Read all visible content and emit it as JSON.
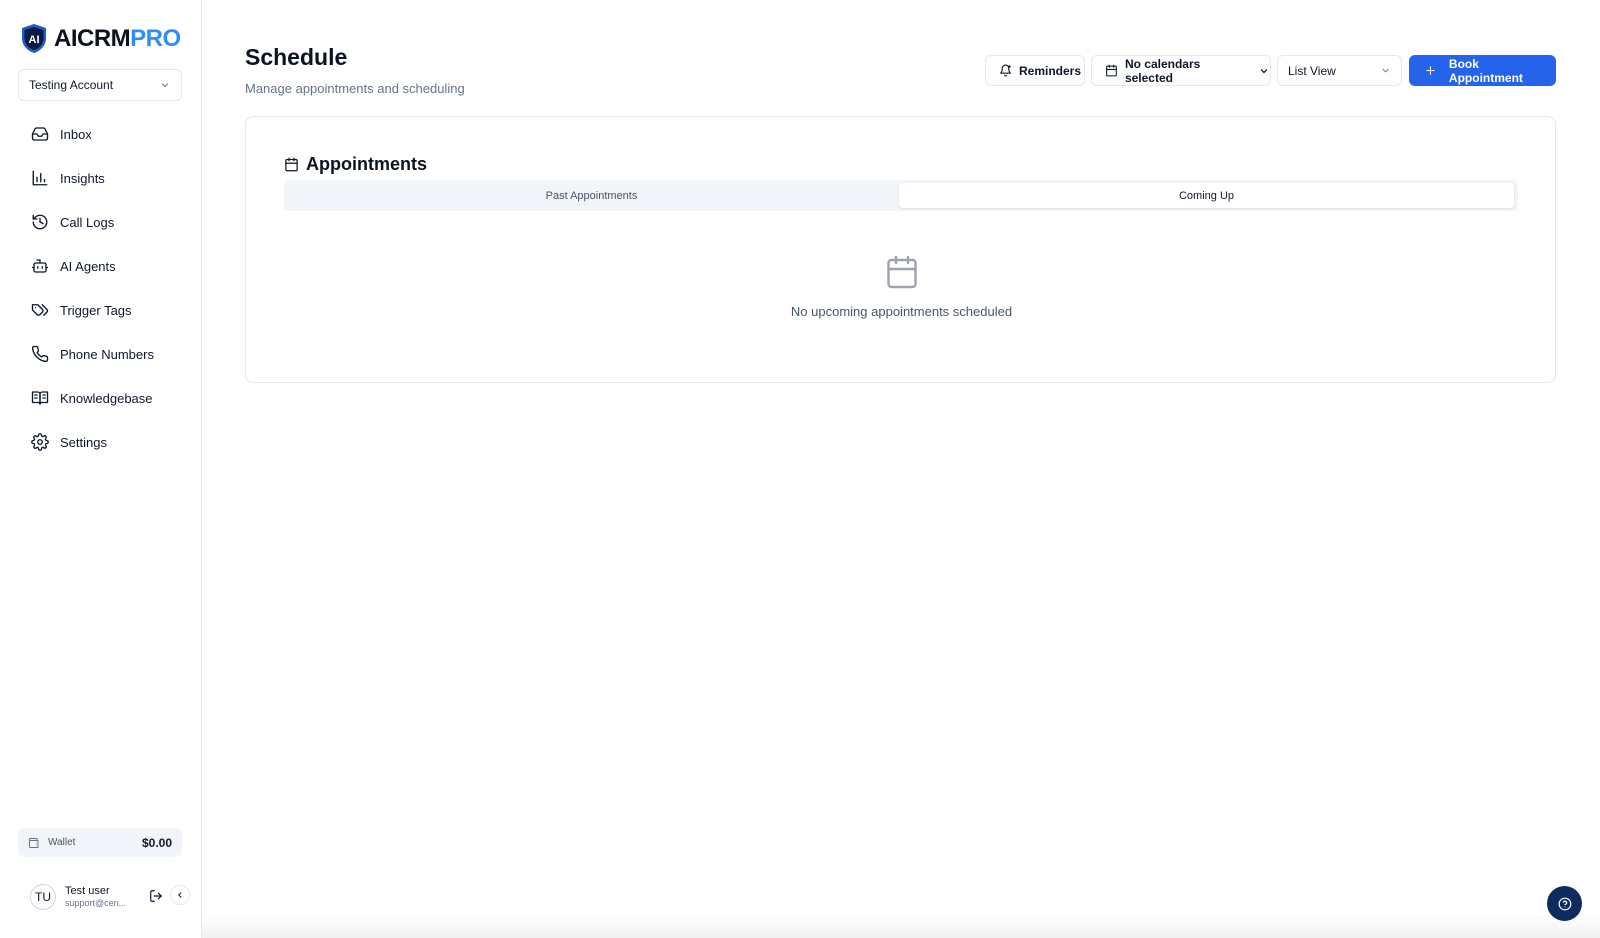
{
  "brand": {
    "name_part1": "AICRM",
    "name_part2": "PRO",
    "shield_text": "AI"
  },
  "account": {
    "selected": "Testing Account"
  },
  "sidebar": {
    "items": [
      {
        "label": "Inbox",
        "icon": "inbox-icon"
      },
      {
        "label": "Insights",
        "icon": "bar-chart-icon"
      },
      {
        "label": "Call Logs",
        "icon": "history-icon"
      },
      {
        "label": "AI Agents",
        "icon": "bot-icon"
      },
      {
        "label": "Trigger Tags",
        "icon": "tags-icon"
      },
      {
        "label": "Phone Numbers",
        "icon": "phone-icon"
      },
      {
        "label": "Knowledgebase",
        "icon": "book-icon"
      },
      {
        "label": "Settings",
        "icon": "gear-icon"
      }
    ]
  },
  "wallet": {
    "label": "Wallet",
    "amount": "$0.00"
  },
  "user": {
    "initials": "TU",
    "name": "Test user",
    "email": "support@cen..."
  },
  "header": {
    "title": "Schedule",
    "subtitle": "Manage appointments and scheduling",
    "reminders_label": "Reminders",
    "calendars_label": "No calendars selected",
    "view_selected": "List View",
    "book_label": "Book Appointment"
  },
  "appointments": {
    "title": "Appointments",
    "tabs": [
      {
        "label": "Past Appointments",
        "active": false
      },
      {
        "label": "Coming Up",
        "active": true
      }
    ],
    "empty_text": "No upcoming appointments scheduled"
  },
  "colors": {
    "accent": "#2563eb",
    "brand_blue": "#2f8ff5",
    "help_button": "#0f2a5e"
  }
}
